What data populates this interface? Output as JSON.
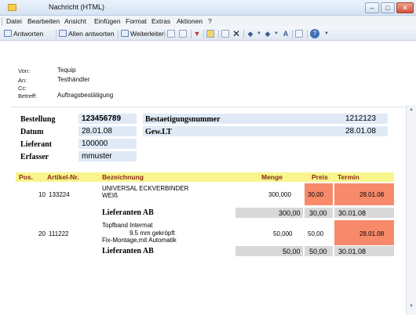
{
  "window": {
    "title": "Nachricht (HTML)",
    "minimize_glyph": "–",
    "maximize_glyph": "□",
    "close_glyph": "✕"
  },
  "menu": [
    "Datei",
    "Bearbeiten",
    "Ansicht",
    "Einfügen",
    "Format",
    "Extras",
    "Aktionen",
    "?"
  ],
  "toolbar": {
    "reply": "Antworten",
    "reply_all": "Allen antworten",
    "forward": "Weiterleiten"
  },
  "header": {
    "from_label": "Von:",
    "from": "Tequip",
    "to_label": "An:",
    "to": "Testhändler",
    "cc_label": "Cc:",
    "cc": "",
    "subject_label": "Betreff:",
    "subject": "Auftragsbestätigung"
  },
  "order": {
    "bestellung_label": "Bestellung",
    "bestellung": "123456789",
    "datum_label": "Datum",
    "datum": "28.01.08",
    "lieferant_label": "Lieferant",
    "lieferant": "100000",
    "erfasser_label": "Erfasser",
    "erfasser": "mmuster",
    "bestaetigung_label": "Bestaetigungsnummer",
    "bestaetigung": "1212123",
    "gewlt_label": "Gew.LT",
    "gewlt": "28.01.08"
  },
  "table": {
    "headers": {
      "pos": "Pos.",
      "artikel": "Artikel-Nr.",
      "bezeichnung": "Bezeichnung",
      "menge": "Menge",
      "preis": "Preis",
      "termin": "Termin"
    },
    "rows": [
      {
        "pos": "10",
        "artikel": "133224",
        "bez1": "UNIVERSAL ECKVERBINDER",
        "bez2": "WEIß",
        "bez3": "",
        "menge": "300,000",
        "preis": "30,00",
        "termin": "28.01.08",
        "lieferant_label": "Lieferanten AB",
        "ab_menge": "300,00",
        "ab_preis": "30,00",
        "ab_termin": "30.01.08"
      },
      {
        "pos": "20",
        "artikel": "111222",
        "bez1": "Topfband Intermat",
        "bez2": "9.5 mm gekröpft",
        "bez3": "Fix-Montage,mit Automatik",
        "menge": "50,000",
        "preis": "50,00",
        "termin": "28.01.08",
        "lieferant_label": "Lieferanten AB",
        "ab_menge": "50,00",
        "ab_preis": "50,00",
        "ab_termin": "30.01.08"
      }
    ]
  },
  "scroll": {
    "up": "▲",
    "down": "▼"
  }
}
